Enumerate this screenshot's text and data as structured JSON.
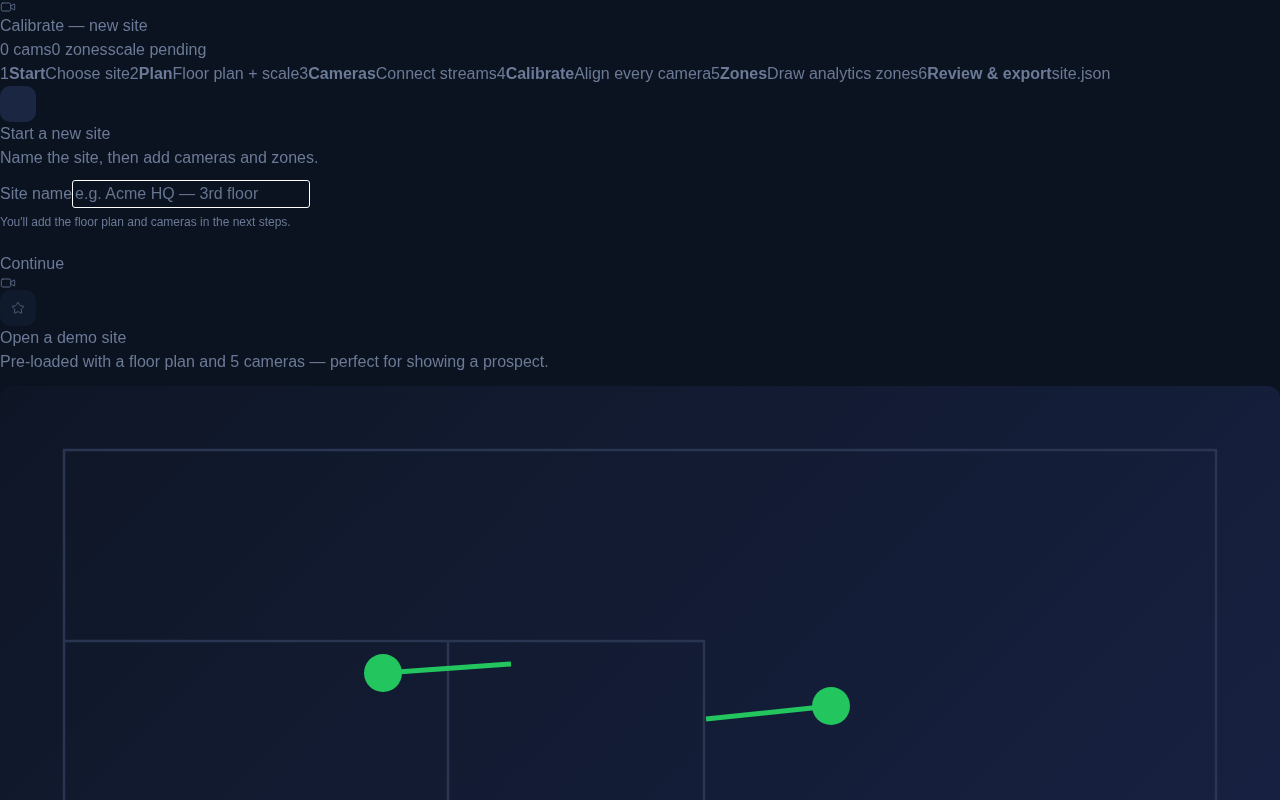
{
  "app": {
    "title": "Calibrate — new site",
    "stats": [
      "0 cams",
      "0 zones",
      "scale pending"
    ]
  },
  "steps": [
    {
      "number": "1",
      "title": "Start",
      "subtitle": "Choose site"
    },
    {
      "number": "2",
      "title": "Plan",
      "subtitle": "Floor plan + scale"
    },
    {
      "number": "3",
      "title": "Cameras",
      "subtitle": "Connect streams"
    },
    {
      "number": "4",
      "title": "Calibrate",
      "subtitle": "Align every camera"
    },
    {
      "number": "5",
      "title": "Zones",
      "subtitle": "Draw analytics zones"
    },
    {
      "number": "6",
      "title": "Review & export",
      "subtitle": "site.json"
    }
  ],
  "new_site": {
    "title": "Start a new site",
    "description": "Name the site, then add cameras and zones.",
    "field": {
      "label": "Site name",
      "placeholder": "e.g. Acme HQ — 3rd floor"
    },
    "hint": "You'll add the floor plan and cameras in the next steps.",
    "button": "Continue"
  },
  "demo_site": {
    "title": "Open a demo site",
    "description": "Pre-loaded with a floor plan and 5 cameras — perfect for showing a prospect."
  }
}
